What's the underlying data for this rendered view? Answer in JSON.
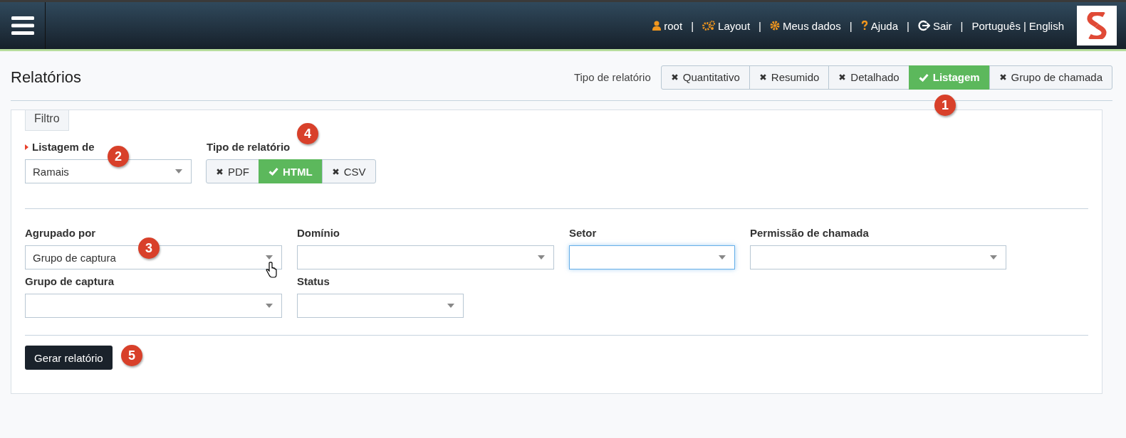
{
  "header": {
    "menu": [
      {
        "kind": "user",
        "label": "root"
      },
      {
        "kind": "separator",
        "label": "|"
      },
      {
        "kind": "layout",
        "label": "Layout"
      },
      {
        "kind": "separator",
        "label": "|"
      },
      {
        "kind": "gear",
        "label": "Meus dados"
      },
      {
        "kind": "separator",
        "label": "|"
      },
      {
        "kind": "help",
        "label": "Ajuda"
      },
      {
        "kind": "separator",
        "label": "|"
      },
      {
        "kind": "logout",
        "label": "Sair"
      },
      {
        "kind": "separator",
        "label": "|"
      },
      {
        "kind": "lang",
        "label": "Português"
      },
      {
        "kind": "lang-separator",
        "label": "|"
      },
      {
        "kind": "lang",
        "label": "English"
      }
    ]
  },
  "page": {
    "title": "Relatórios",
    "report_type_label": "Tipo de relatório",
    "report_types": [
      {
        "label": "Quantitativo",
        "selected": false
      },
      {
        "label": "Resumido",
        "selected": false
      },
      {
        "label": "Detalhado",
        "selected": false
      },
      {
        "label": "Listagem",
        "selected": true
      },
      {
        "label": "Grupo de chamada",
        "selected": false
      }
    ]
  },
  "filter": {
    "tab": "Filtro",
    "listing": {
      "label": "Listagem de",
      "required": true,
      "value": "Ramais"
    },
    "format": {
      "label": "Tipo de relatório",
      "options": [
        {
          "label": "PDF",
          "selected": false
        },
        {
          "label": "HTML",
          "selected": true
        },
        {
          "label": "CSV",
          "selected": false
        }
      ]
    },
    "fields": [
      [
        {
          "label": "Agrupado por",
          "value": "Grupo de captura",
          "focused": false
        },
        {
          "label": "Domínio",
          "focused": false
        },
        {
          "label": "Setor",
          "focused": true
        },
        {
          "label": "Permissão de chamada",
          "focused": false
        }
      ],
      [
        {
          "label": "Grupo de captura",
          "focused": false
        },
        {
          "label": "Status",
          "focused": false
        }
      ]
    ],
    "submit": "Gerar relatório"
  },
  "annotations": [
    "1",
    "2",
    "3",
    "4",
    "5"
  ]
}
